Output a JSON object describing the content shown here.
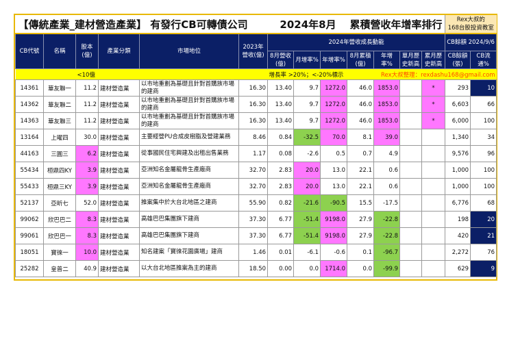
{
  "title": "【傳統產業_建材營造產業】 有發行CB可轉債公司",
  "month": "2024年8月",
  "subtitle": "累積營收年增率排行",
  "rex_badge": [
    "Rex大叔的",
    "168台股投資教室"
  ],
  "headers": {
    "code": "CB代號",
    "name": "名稱",
    "capital": "股本(億)",
    "industry": "產業分類",
    "position": "市場地位",
    "rev2023": "2023年營收(億)",
    "group": "2024年營收成長動能",
    "cb_group": "CB餘額 2024/9/6",
    "aug_rev": "8月營收(億)",
    "mom": "月增率%",
    "yoy": "年增率%",
    "aug_cum": "8月累積(億)",
    "cum_yoy": "年增率%",
    "month_high": "單月歷史新高",
    "cum_high": "累月歷史新高",
    "cb_balance": "CB餘額(張)",
    "cb_pct": "CB流通%"
  },
  "notes": {
    "capital": "<10億",
    "growth": "增長率 >20%；<-20%標示",
    "credit": "Rex大叔整理：rexdashu168@gmail.com"
  },
  "colors": {
    "magenta": "#ff77ff",
    "green": "#8dd14f",
    "navy": "#0b1f66",
    "gold": "#e8b800",
    "yellow": "#ffff00",
    "credit": "#ff4400"
  },
  "rows": [
    {
      "code": "14361",
      "name": "華友聯一",
      "capital": "11.2",
      "industry": "建材營造業",
      "position": "以市地重劃為基礎且針對首購族市場的建商",
      "rev2023": "16.30",
      "aug_rev": "13.40",
      "mom": "9.7",
      "yoy": "1272.0",
      "aug_cum": "46.0",
      "cum_yoy": "1853.0",
      "month_high": "",
      "cum_high": "*",
      "cb_balance": "293",
      "cb_pct": "10",
      "hl": {
        "yoy": "m",
        "cum_yoy": "m",
        "cum_high": "m",
        "cb_pct": "n"
      }
    },
    {
      "code": "14362",
      "name": "華友聯二",
      "capital": "11.2",
      "industry": "建材營造業",
      "position": "以市地重劃為基礎且針對首購族市場的建商",
      "rev2023": "16.30",
      "aug_rev": "13.40",
      "mom": "9.7",
      "yoy": "1272.0",
      "aug_cum": "46.0",
      "cum_yoy": "1853.0",
      "month_high": "",
      "cum_high": "*",
      "cb_balance": "6,603",
      "cb_pct": "66",
      "hl": {
        "yoy": "m",
        "cum_yoy": "m",
        "cum_high": "m"
      }
    },
    {
      "code": "14363",
      "name": "華友聯三",
      "capital": "11.2",
      "industry": "建材營造業",
      "position": "以市地重劃為基礎且針對首購族市場的建商",
      "rev2023": "16.30",
      "aug_rev": "13.40",
      "mom": "9.7",
      "yoy": "1272.0",
      "aug_cum": "46.0",
      "cum_yoy": "1853.0",
      "month_high": "",
      "cum_high": "*",
      "cb_balance": "6,000",
      "cb_pct": "100",
      "hl": {
        "yoy": "m",
        "cum_yoy": "m",
        "cum_high": "m"
      }
    },
    {
      "code": "13164",
      "name": "上曜四",
      "capital": "30.0",
      "industry": "建材營造業",
      "position": "主要經營PU合成皮樹脂及營建業務",
      "rev2023": "8.46",
      "aug_rev": "0.84",
      "mom": "-32.5",
      "yoy": "70.0",
      "aug_cum": "8.1",
      "cum_yoy": "39.0",
      "month_high": "",
      "cum_high": "",
      "cb_balance": "1,340",
      "cb_pct": "34",
      "hl": {
        "mom": "g",
        "yoy": "m",
        "cum_yoy": "m"
      }
    },
    {
      "code": "44163",
      "name": "三圓三",
      "capital": "6.2",
      "industry": "建材營造業",
      "position": "從事國民住宅興建及出租出售業務",
      "rev2023": "1.17",
      "aug_rev": "0.08",
      "mom": "-2.6",
      "yoy": "0.5",
      "aug_cum": "0.7",
      "cum_yoy": "4.9",
      "month_high": "",
      "cum_high": "",
      "cb_balance": "9,576",
      "cb_pct": "96",
      "hl": {
        "capital": "m"
      }
    },
    {
      "code": "55434",
      "name": "桓鼎四KY",
      "capital": "3.9",
      "industry": "建材營造業",
      "position": "亞洲知名金屬龍骨生產廠商",
      "rev2023": "32.70",
      "aug_rev": "2.83",
      "mom": "20.0",
      "yoy": "13.0",
      "aug_cum": "22.1",
      "cum_yoy": "0.6",
      "month_high": "",
      "cum_high": "",
      "cb_balance": "1,000",
      "cb_pct": "100",
      "hl": {
        "capital": "m",
        "mom": "m"
      }
    },
    {
      "code": "55433",
      "name": "桓鼎三KY",
      "capital": "3.9",
      "industry": "建材營造業",
      "position": "亞洲知名金屬龍骨生產廠商",
      "rev2023": "32.70",
      "aug_rev": "2.83",
      "mom": "20.0",
      "yoy": "13.0",
      "aug_cum": "22.1",
      "cum_yoy": "0.6",
      "month_high": "",
      "cum_high": "",
      "cb_balance": "1,000",
      "cb_pct": "100",
      "hl": {
        "capital": "m",
        "mom": "m"
      }
    },
    {
      "code": "52137",
      "name": "亞昕七",
      "capital": "52.0",
      "industry": "建材營造業",
      "position": "推案集中於大台北地區之建商",
      "rev2023": "55.90",
      "aug_rev": "0.82",
      "mom": "-21.6",
      "yoy": "-90.5",
      "aug_cum": "15.5",
      "cum_yoy": "-17.5",
      "month_high": "",
      "cum_high": "",
      "cb_balance": "6,776",
      "cb_pct": "68",
      "hl": {
        "mom": "g",
        "yoy": "g"
      }
    },
    {
      "code": "99062",
      "name": "欣巴巴二",
      "capital": "8.3",
      "industry": "建材營造業",
      "position": "高雄巴巴集團旗下建商",
      "rev2023": "37.30",
      "aug_rev": "6.77",
      "mom": "-51.4",
      "yoy": "9198.0",
      "aug_cum": "27.9",
      "cum_yoy": "-22.8",
      "month_high": "",
      "cum_high": "",
      "cb_balance": "198",
      "cb_pct": "20",
      "hl": {
        "capital": "m",
        "mom": "g",
        "yoy": "m",
        "cum_yoy": "g",
        "cb_pct": "n"
      }
    },
    {
      "code": "99061",
      "name": "欣巴巴一",
      "capital": "8.3",
      "industry": "建材營造業",
      "position": "高雄巴巴集團旗下建商",
      "rev2023": "37.30",
      "aug_rev": "6.77",
      "mom": "-51.4",
      "yoy": "9198.0",
      "aug_cum": "27.9",
      "cum_yoy": "-22.8",
      "month_high": "",
      "cum_high": "",
      "cb_balance": "420",
      "cb_pct": "21",
      "hl": {
        "capital": "m",
        "mom": "g",
        "yoy": "m",
        "cum_yoy": "g",
        "cb_pct": "n"
      }
    },
    {
      "code": "18051",
      "name": "寶徠一",
      "capital": "10.0",
      "industry": "建材營造業",
      "position": "知名建案「寶徠花園廣場」建商",
      "rev2023": "1.46",
      "aug_rev": "0.01",
      "mom": "-6.1",
      "yoy": "-0.6",
      "aug_cum": "0.1",
      "cum_yoy": "-96.7",
      "month_high": "",
      "cum_high": "",
      "cb_balance": "2,272",
      "cb_pct": "76",
      "hl": {
        "capital": "m",
        "cum_yoy": "g"
      }
    },
    {
      "code": "25282",
      "name": "皇普二",
      "capital": "40.9",
      "industry": "建材營造業",
      "position": "以大台北地區推案為主的建商",
      "rev2023": "18.50",
      "aug_rev": "0.00",
      "mom": "0.0",
      "yoy": "1714.0",
      "aug_cum": "0.0",
      "cum_yoy": "-99.9",
      "month_high": "",
      "cum_high": "",
      "cb_balance": "629",
      "cb_pct": "9",
      "hl": {
        "yoy": "m",
        "cum_yoy": "g",
        "cb_pct": "n"
      }
    }
  ]
}
